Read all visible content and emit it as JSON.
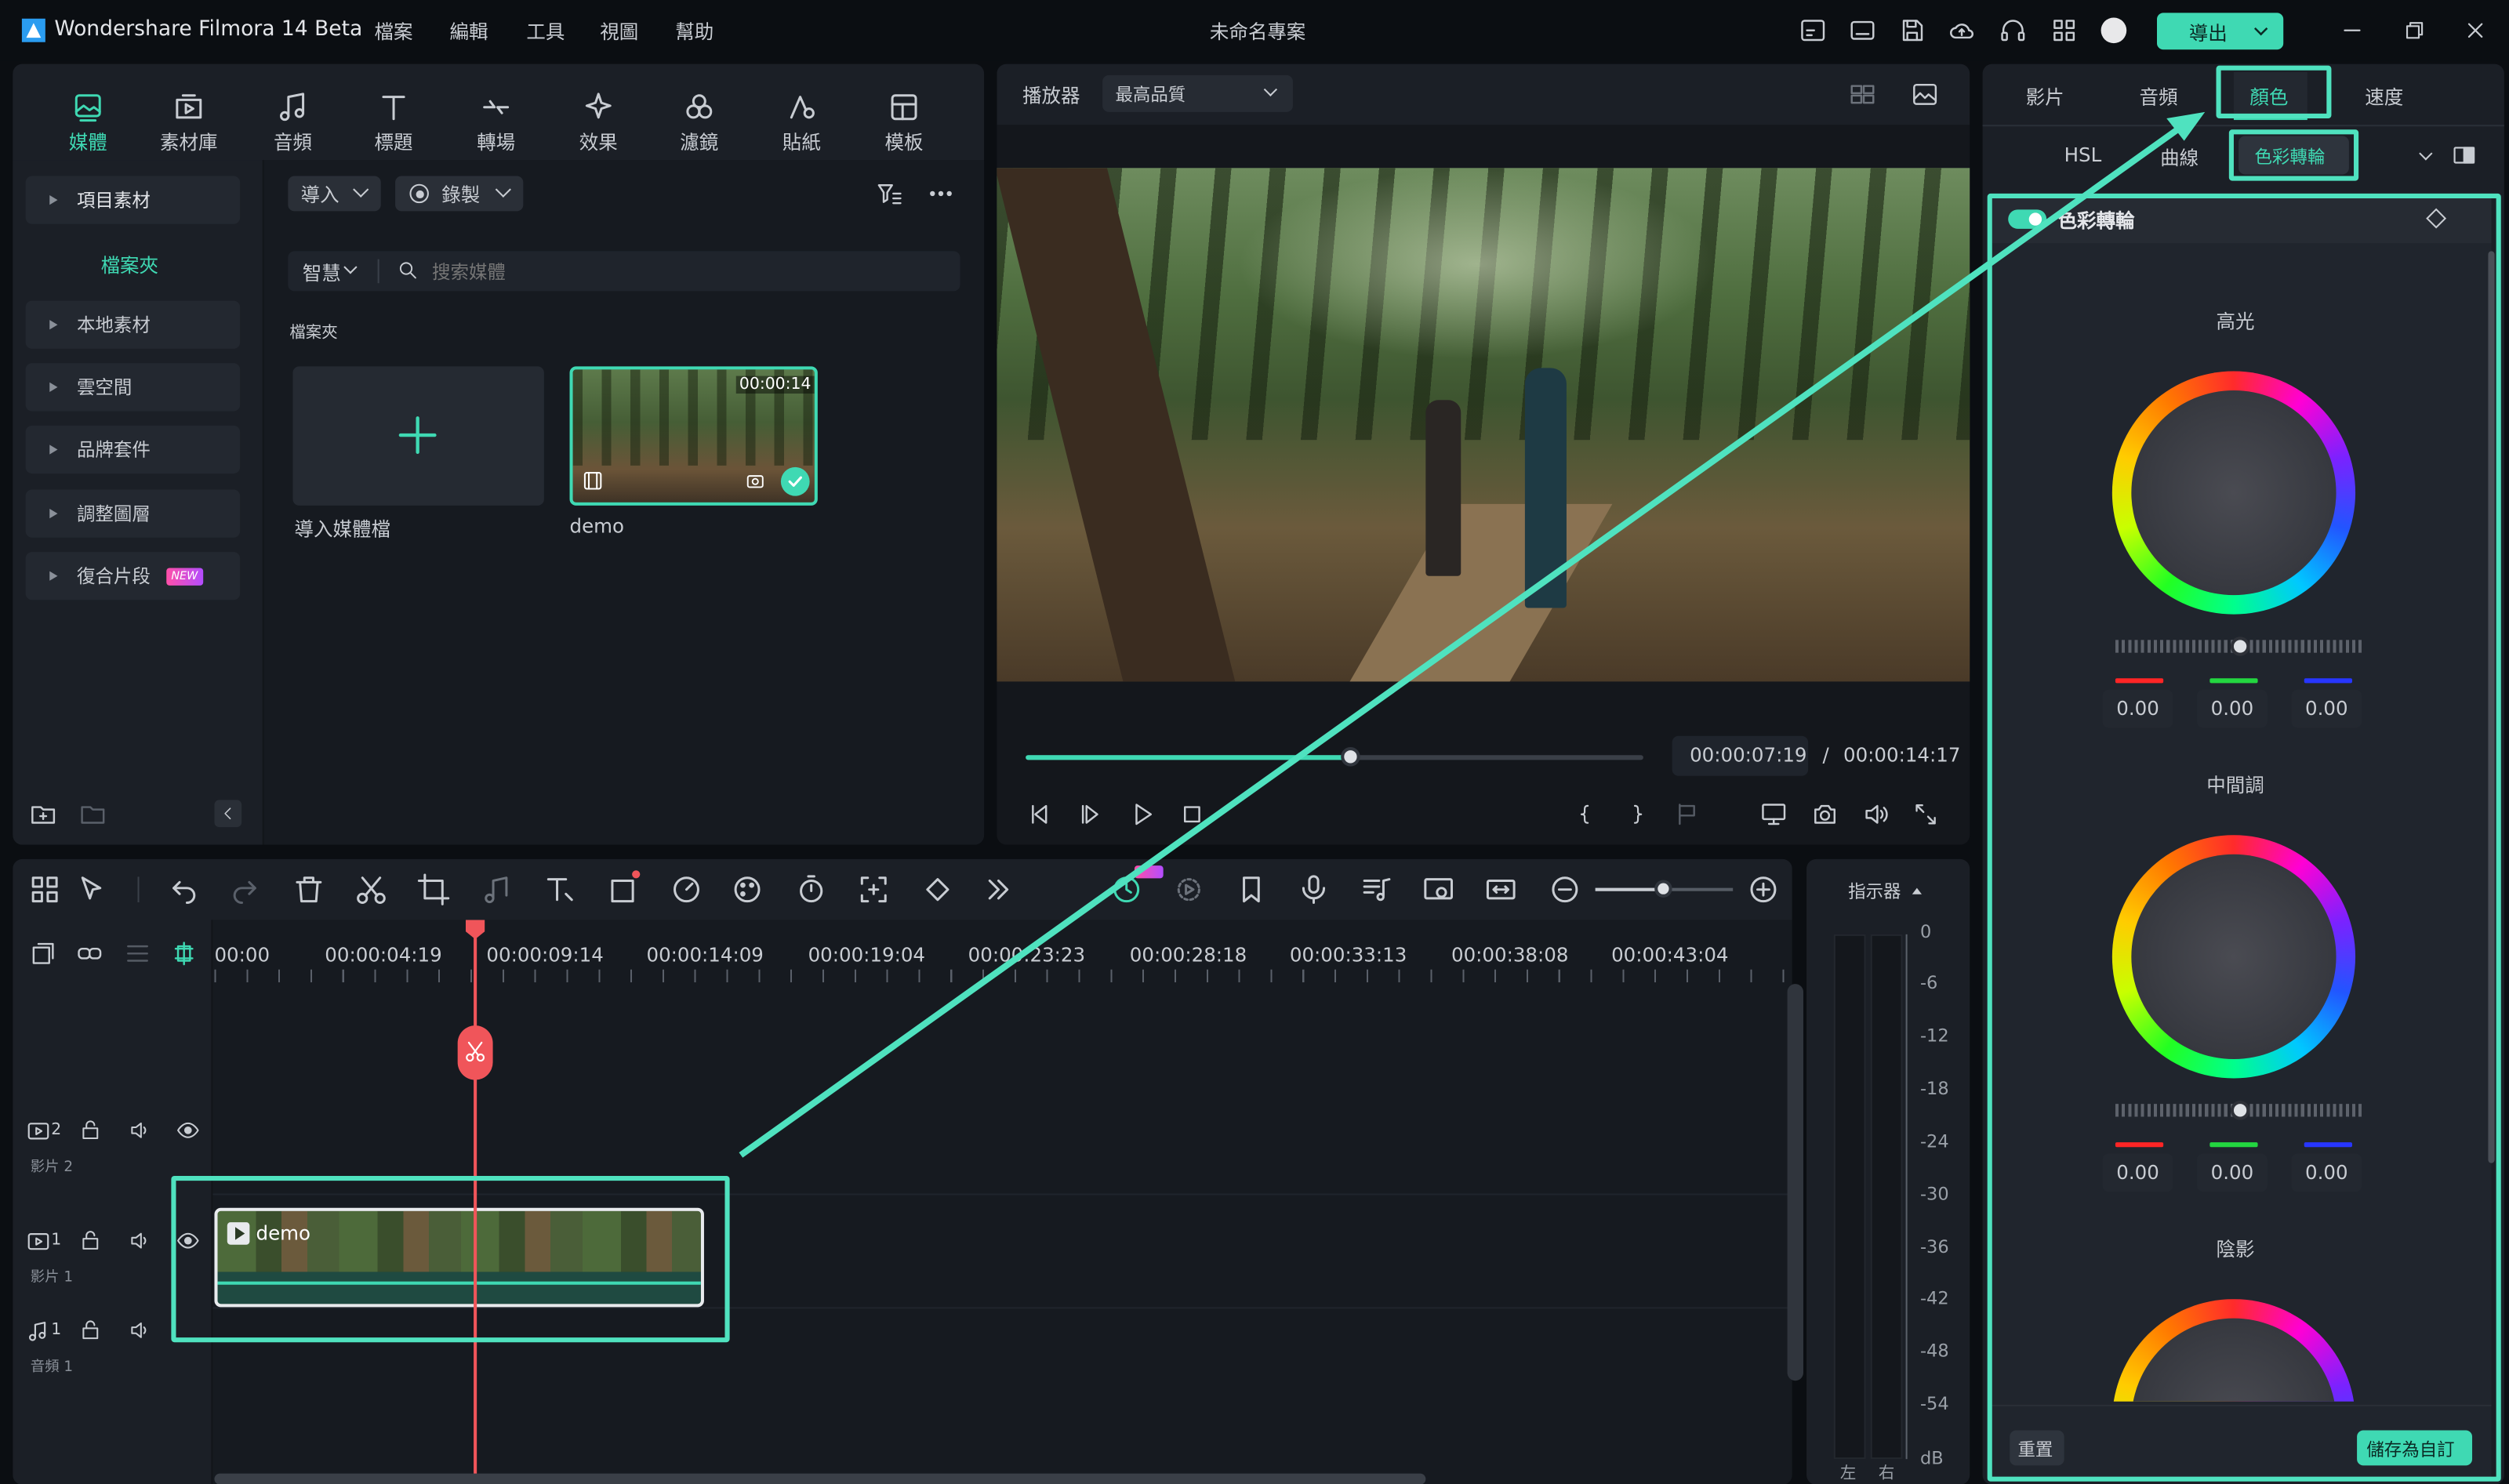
{
  "app": {
    "title": "Wondershare Filmora 14 Beta",
    "project": "未命名專案"
  },
  "menu": [
    "檔案",
    "編輯",
    "工具",
    "視圖",
    "幫助"
  ],
  "export_label": "導出",
  "media_toolbar": [
    {
      "label": "媒體",
      "icon": "media-icon",
      "active": true
    },
    {
      "label": "素材庫",
      "icon": "stock-icon"
    },
    {
      "label": "音頻",
      "icon": "music-note-icon"
    },
    {
      "label": "標題",
      "icon": "title-t-icon"
    },
    {
      "label": "轉場",
      "icon": "transition-icon"
    },
    {
      "label": "效果",
      "icon": "sparkle-icon"
    },
    {
      "label": "濾鏡",
      "icon": "filter-icon"
    },
    {
      "label": "貼紙",
      "icon": "sticker-icon"
    },
    {
      "label": "模板",
      "icon": "template-icon"
    }
  ],
  "sidebar": {
    "project_media": "項目素材",
    "folder": "檔案夾",
    "items": [
      "本地素材",
      "雲空間",
      "品牌套件",
      "調整圖層",
      "復合片段"
    ],
    "new_badge": "NEW"
  },
  "media_panel": {
    "import_label": "導入",
    "record_label": "錄製",
    "smart_label": "智慧",
    "search_placeholder": "搜索媒體",
    "folder_label": "檔案夾",
    "import_tile_label": "導入媒體檔",
    "clip": {
      "name": "demo",
      "duration": "00:00:14"
    }
  },
  "player": {
    "label": "播放器",
    "quality": "最高品質",
    "current_time": "00:00:07:19",
    "separator": "/",
    "total_time": "00:00:14:17",
    "progress": 0.527
  },
  "right_panel": {
    "tabs": [
      "影片",
      "音頻",
      "顏色",
      "速度"
    ],
    "active_tab": "顏色",
    "subtabs": [
      "HSL",
      "曲線",
      "色彩轉輪"
    ],
    "active_subtab": "色彩轉輪",
    "section_title": "色彩轉輪",
    "wheels": [
      {
        "label": "高光",
        "r": "0.00",
        "g": "0.00",
        "b": "0.00",
        "level": 0.5
      },
      {
        "label": "中間調",
        "r": "0.00",
        "g": "0.00",
        "b": "0.00",
        "level": 0.5
      },
      {
        "label": "陰影"
      }
    ],
    "reset_label": "重置",
    "save_label": "儲存為自訂"
  },
  "timeline": {
    "ruler": [
      "00:00",
      "00:00:04:19",
      "00:00:09:14",
      "00:00:14:09",
      "00:00:19:04",
      "00:00:23:23",
      "00:00:28:18",
      "00:00:33:13",
      "00:00:38:08",
      "00:00:43:04"
    ],
    "tracks": [
      {
        "num": "2",
        "name": "影片 2"
      },
      {
        "num": "1",
        "name": "影片 1"
      },
      {
        "num": "1",
        "name": "音頻 1"
      }
    ],
    "clip_name": "demo",
    "meter_label": "指示器",
    "db_scale": [
      "0",
      "-6",
      "-12",
      "-18",
      "-24",
      "-30",
      "-36",
      "-42",
      "-48",
      "-54",
      "dB"
    ],
    "left": "左",
    "right": "右"
  },
  "colors": {
    "accent": "#4fe2bf",
    "playhead": "#f0555a",
    "panel": "#1b1f26",
    "background": "#0b0e12"
  }
}
